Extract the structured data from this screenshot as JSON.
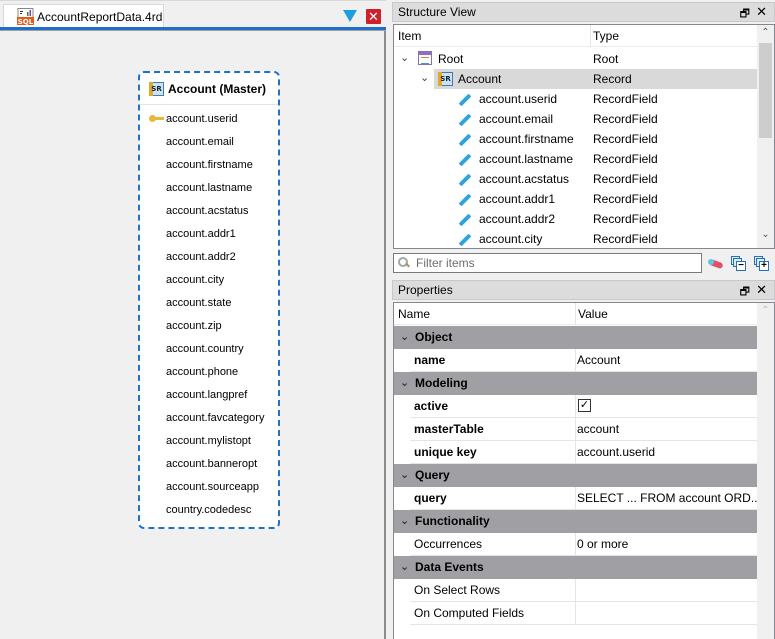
{
  "document": {
    "tab_label": "AccountReportData.4rd",
    "tab_icon": "sql-report-icon",
    "filter_icon": "filter-triangle-icon",
    "close_icon": "close-document-icon"
  },
  "entity": {
    "title": "Account (Master)",
    "icon": "record-icon",
    "key_field_index": 0,
    "fields": [
      "account.userid",
      "account.email",
      "account.firstname",
      "account.lastname",
      "account.acstatus",
      "account.addr1",
      "account.addr2",
      "account.city",
      "account.state",
      "account.zip",
      "account.country",
      "account.phone",
      "account.langpref",
      "account.favcategory",
      "account.mylistopt",
      "account.banneropt",
      "account.sourceapp",
      "country.codedesc"
    ]
  },
  "structure_view": {
    "title": "Structure View",
    "columns": {
      "item": "Item",
      "type": "Type"
    },
    "rows": [
      {
        "name": "Root",
        "type": "Root",
        "level": 0,
        "icon": "root-icon",
        "expanded": true
      },
      {
        "name": "Account",
        "type": "Record",
        "level": 1,
        "icon": "record-icon",
        "expanded": true,
        "selected": true
      },
      {
        "name": "account.userid",
        "type": "RecordField",
        "level": 2,
        "icon": "field-pencil-icon"
      },
      {
        "name": "account.email",
        "type": "RecordField",
        "level": 2,
        "icon": "field-pencil-icon"
      },
      {
        "name": "account.firstname",
        "type": "RecordField",
        "level": 2,
        "icon": "field-pencil-icon"
      },
      {
        "name": "account.lastname",
        "type": "RecordField",
        "level": 2,
        "icon": "field-pencil-icon"
      },
      {
        "name": "account.acstatus",
        "type": "RecordField",
        "level": 2,
        "icon": "field-pencil-icon"
      },
      {
        "name": "account.addr1",
        "type": "RecordField",
        "level": 2,
        "icon": "field-pencil-icon"
      },
      {
        "name": "account.addr2",
        "type": "RecordField",
        "level": 2,
        "icon": "field-pencil-icon"
      },
      {
        "name": "account.city",
        "type": "RecordField",
        "level": 2,
        "icon": "field-pencil-icon"
      }
    ],
    "filter_placeholder": "Filter items",
    "filter_value": ""
  },
  "properties": {
    "title": "Properties",
    "columns": {
      "name": "Name",
      "value": "Value"
    },
    "groups": [
      {
        "name": "Object",
        "props": [
          {
            "name": "name",
            "value": "Account",
            "bold": true
          }
        ]
      },
      {
        "name": "Modeling",
        "props": [
          {
            "name": "active",
            "value": "",
            "checkbox": true,
            "checked": true,
            "bold": true
          },
          {
            "name": "masterTable",
            "value": "account",
            "bold": true
          },
          {
            "name": "unique key",
            "value": "account.userid",
            "bold": true
          }
        ]
      },
      {
        "name": "Query",
        "props": [
          {
            "name": "query",
            "value": "SELECT ... FROM account  ORD...",
            "bold": true
          }
        ]
      },
      {
        "name": "Functionality",
        "props": [
          {
            "name": "Occurrences",
            "value": "0 or more",
            "bold": false
          }
        ]
      },
      {
        "name": "Data Events",
        "props": [
          {
            "name": "On Select Rows",
            "value": "",
            "bold": false
          },
          {
            "name": "On Computed Fields",
            "value": "",
            "bold": false
          }
        ]
      }
    ]
  },
  "glyphs": {
    "float": "🗗",
    "close": "✕",
    "chev_down": "⌄",
    "scroll_up": "⌃",
    "scroll_down": "⌄",
    "check": "✓",
    "x": "✕"
  }
}
